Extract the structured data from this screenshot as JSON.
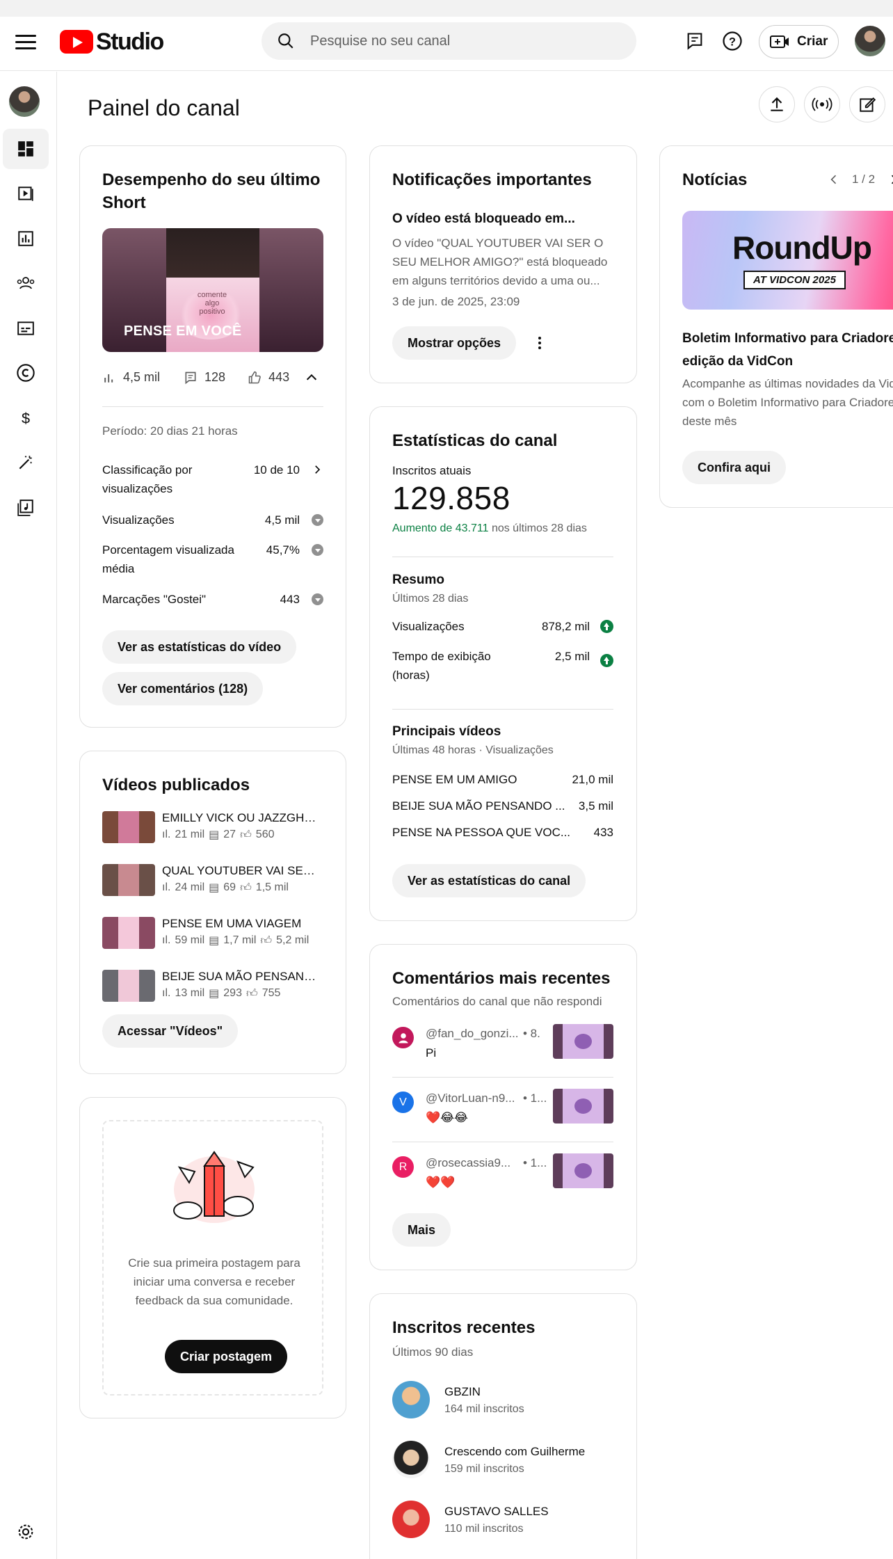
{
  "header": {
    "brand": "Studio",
    "search_placeholder": "Pesquise no seu canal",
    "create_label": "Criar"
  },
  "page": {
    "title": "Painel do canal"
  },
  "short_card": {
    "title": "Desempenho do seu último Short",
    "thumb_caption": "PENSE EM VOCÊ",
    "thumb_overlay": "comente algo positivo",
    "views": "4,5 mil",
    "comments": "128",
    "likes": "443",
    "period": "Período: 20 dias 21 horas",
    "metrics": [
      {
        "label": "Classificação por visualizações",
        "value": "10 de 10"
      },
      {
        "label": "Visualizações",
        "value": "4,5 mil"
      },
      {
        "label": "Porcentagem visualizada média",
        "value": "45,7%"
      },
      {
        "label": "Marcações \"Gostei\"",
        "value": "443"
      }
    ],
    "btn_stats": "Ver as estatísticas do vídeo",
    "btn_comments": "Ver comentários (128)"
  },
  "published": {
    "title": "Vídeos publicados",
    "videos": [
      {
        "title": "EMILLY VICK OU JAZZGHOST...",
        "views": "21 mil",
        "comments": "27",
        "likes": "560",
        "thumb": "#8a4a4a"
      },
      {
        "title": "QUAL YOUTUBER VAI SER O SEU...",
        "views": "24 mil",
        "comments": "69",
        "likes": "1,5 mil",
        "thumb": "#7a5a52"
      },
      {
        "title": "PENSE EM UMA VIAGEM",
        "views": "59 mil",
        "comments": "1,7 mil",
        "likes": "5,2 mil",
        "thumb": "#9a4a6a"
      },
      {
        "title": "BEIJE SUA MÃO PENSANDO...",
        "views": "13 mil",
        "comments": "293",
        "likes": "755",
        "thumb": "#6a6a70"
      }
    ],
    "btn": "Acessar \"Vídeos\""
  },
  "post_card": {
    "text": "Crie sua primeira postagem para iniciar uma conversa e receber feedback da sua comunidade.",
    "btn": "Criar postagem"
  },
  "notifications": {
    "title": "Notificações importantes",
    "item_title": "O vídeo está bloqueado em...",
    "item_body": "O vídeo \"QUAL YOUTUBER VAI SER O SEU MELHOR AMIGO?\" está bloqueado em alguns territórios devido a uma ou...",
    "item_date": "3 de jun. de 2025, 23:09",
    "btn": "Mostrar opções"
  },
  "channel_stats": {
    "title": "Estatísticas do canal",
    "subs_label": "Inscritos atuais",
    "subs_value": "129.858",
    "growth_green": "Aumento de 43.711",
    "growth_rest": "nos últimos 28 dias",
    "summary_title": "Resumo",
    "summary_sub": "Últimos 28 dias",
    "summary": [
      {
        "label": "Visualizações",
        "value": "878,2 mil"
      },
      {
        "label": "Tempo de exibição (horas)",
        "value": "2,5 mil"
      }
    ],
    "top_title": "Principais vídeos",
    "top_sub": "Últimas 48 horas · Visualizações",
    "top_videos": [
      {
        "title": "PENSE EM UM AMIGO",
        "value": "21,0 mil"
      },
      {
        "title": "BEIJE SUA MÃO PENSANDO ...",
        "value": "3,5 mil"
      },
      {
        "title": "PENSE NA PESSOA QUE VOC...",
        "value": "433"
      }
    ],
    "btn": "Ver as estatísticas do canal"
  },
  "comments": {
    "title": "Comentários mais recentes",
    "subtitle": "Comentários do canal que não respondi",
    "items": [
      {
        "author": "@fan_do_gonzi...",
        "time": "• 8.",
        "text": "Pi",
        "initial": "",
        "color": "#c2185b"
      },
      {
        "author": "@VitorLuan-n9...",
        "time": "• 1...",
        "text": "❤️😂😂",
        "initial": "V",
        "color": "#1a73e8"
      },
      {
        "author": "@rosecassia9...",
        "time": "• 1...",
        "text": "❤️❤️",
        "initial": "R",
        "color": "#e91e63"
      }
    ],
    "btn": "Mais"
  },
  "subscribers": {
    "title": "Inscritos recentes",
    "subtitle": "Últimos 90 dias",
    "items": [
      {
        "name": "GBZIN",
        "count": "164 mil inscritos"
      },
      {
        "name": "Crescendo com Guilherme",
        "count": "159 mil inscritos"
      },
      {
        "name": "GUSTAVO SALLES",
        "count": "110 mil inscritos"
      }
    ]
  },
  "news": {
    "title": "Notícias",
    "pager": "1 / 2",
    "banner_main": "RoundUp",
    "banner_sub": "AT VIDCON 2025",
    "item_title": "Boletim Informativo para Criadores: edição da VidCon",
    "item_body": "Acompanhe as últimas novidades da VidCon com o Boletim Informativo para Criadores deste mês",
    "btn": "Confira aqui"
  }
}
